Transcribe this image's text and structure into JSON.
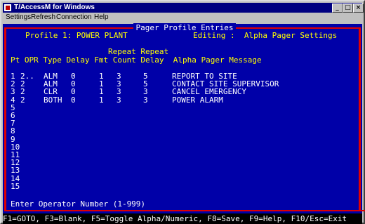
{
  "window": {
    "title": "T/AccessM for Windows",
    "buttons": {
      "minimize": "_",
      "maximize": "□",
      "close": "×"
    }
  },
  "menu": [
    "Settings",
    "Refresh",
    "Connection",
    "Help"
  ],
  "screen": {
    "title": "Pager Profile Entries",
    "profile_label": "Profile 1: POWER PLANT",
    "editing_label": "Editing :  Alpha Pager Settings",
    "headers": {
      "line1": "Repeat Repeat",
      "line2": "Pt OPR Type Delay Fmt Count Delay  Alpha Pager Message"
    },
    "rows": [
      {
        "pt": "1",
        "opr": "2..",
        "type": "ALM",
        "delay": "0",
        "fmt": "1",
        "count": "3",
        "rdelay": "5",
        "message": "REPORT TO SITE"
      },
      {
        "pt": "2",
        "opr": "2",
        "type": "ALM",
        "delay": "0",
        "fmt": "1",
        "count": "3",
        "rdelay": "5",
        "message": "CONTACT SITE SUPERVISOR"
      },
      {
        "pt": "3",
        "opr": "2",
        "type": "CLR",
        "delay": "0",
        "fmt": "1",
        "count": "3",
        "rdelay": "3",
        "message": "CANCEL EMERGENCY"
      },
      {
        "pt": "4",
        "opr": "2",
        "type": "BOTH",
        "delay": "0",
        "fmt": "1",
        "count": "3",
        "rdelay": "3",
        "message": "POWER ALARM"
      },
      {
        "pt": "5"
      },
      {
        "pt": "6"
      },
      {
        "pt": "7"
      },
      {
        "pt": "8"
      },
      {
        "pt": "9"
      },
      {
        "pt": "10"
      },
      {
        "pt": "11"
      },
      {
        "pt": "12"
      },
      {
        "pt": "13"
      },
      {
        "pt": "14"
      },
      {
        "pt": "15"
      }
    ],
    "prompt": "Enter Operator Number (1-999)"
  },
  "status_bar": "F1=GOTO, F3=Blank, F5=Toggle Alpha/Numeric, F8=Save, F9=Help, F10/Esc=Exit"
}
